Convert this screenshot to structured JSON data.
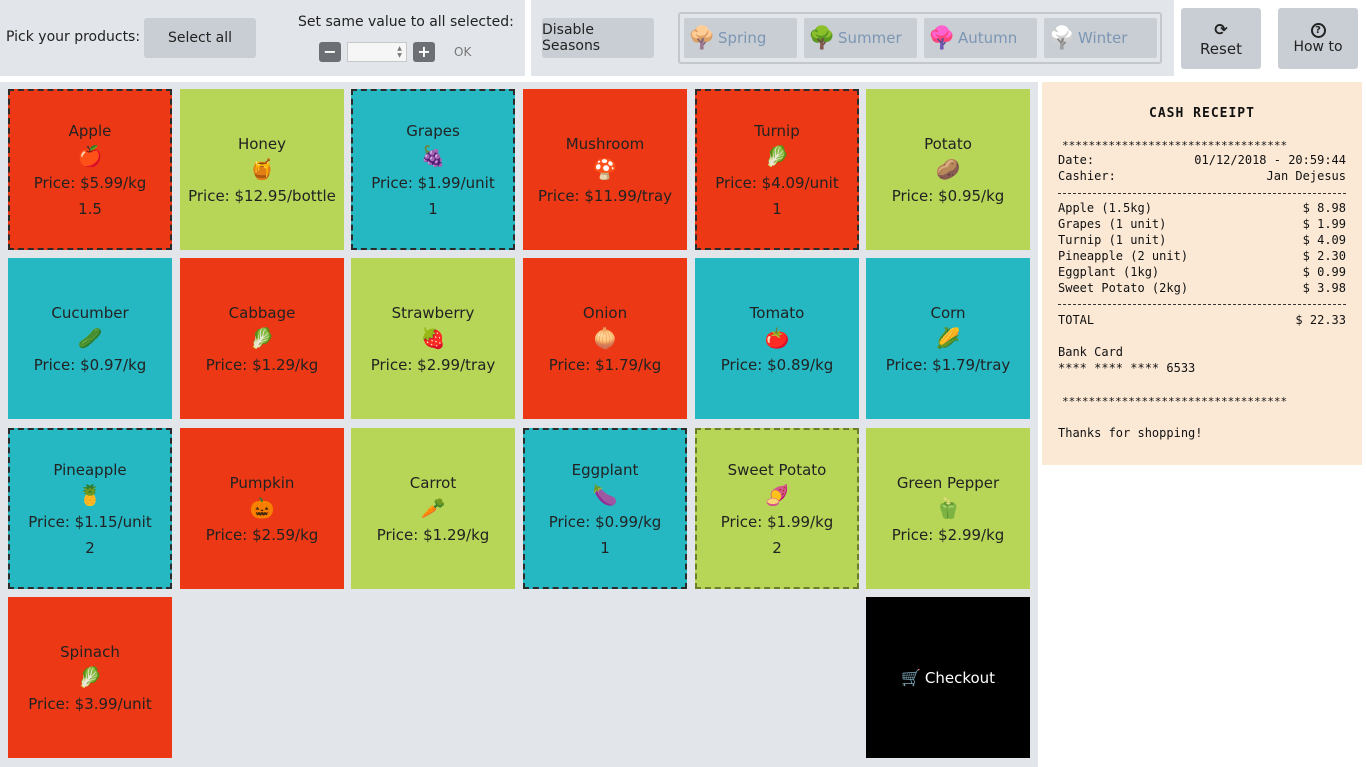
{
  "toolbar": {
    "pick_label": "Pick your products:",
    "select_all": "Select all",
    "same_value_label": "Set same value to all selected:",
    "minus": "−",
    "plus": "+",
    "qty_value": "",
    "ok": "OK",
    "disable_seasons": "Disable Seasons",
    "seasons": [
      {
        "label": "Spring",
        "icon": "🌳"
      },
      {
        "label": "Summer",
        "icon": "🌳"
      },
      {
        "label": "Autumn",
        "icon": "🌳"
      },
      {
        "label": "Winter",
        "icon": "🌳"
      }
    ],
    "reset": "Reset",
    "reset_icon": "⟳",
    "howto": "How to",
    "howto_icon": "?"
  },
  "products": [
    {
      "name": "Apple",
      "icon": "🍎",
      "price": "Price: $5.99/kg",
      "qty": "1.5"
    },
    {
      "name": "Honey",
      "icon": "🍯",
      "price": "Price: $12.95/bottle",
      "qty": ""
    },
    {
      "name": "Grapes",
      "icon": "🍇",
      "price": "Price: $1.99/unit",
      "qty": "1"
    },
    {
      "name": "Mushroom",
      "icon": "🍄",
      "price": "Price: $11.99/tray",
      "qty": ""
    },
    {
      "name": "Turnip",
      "icon": "🥬",
      "price": "Price: $4.09/unit",
      "qty": "1"
    },
    {
      "name": "Potato",
      "icon": "🥔",
      "price": "Price: $0.95/kg",
      "qty": ""
    },
    {
      "name": "Cucumber",
      "icon": "🥒",
      "price": "Price: $0.97/kg",
      "qty": ""
    },
    {
      "name": "Cabbage",
      "icon": "🥬",
      "price": "Price: $1.29/kg",
      "qty": ""
    },
    {
      "name": "Strawberry",
      "icon": "🍓",
      "price": "Price: $2.99/tray",
      "qty": ""
    },
    {
      "name": "Onion",
      "icon": "🧅",
      "price": "Price: $1.79/kg",
      "qty": ""
    },
    {
      "name": "Tomato",
      "icon": "🍅",
      "price": "Price: $0.89/kg",
      "qty": ""
    },
    {
      "name": "Corn",
      "icon": "🌽",
      "price": "Price: $1.79/tray",
      "qty": ""
    },
    {
      "name": "Pineapple",
      "icon": "🍍",
      "price": "Price: $1.15/unit",
      "qty": "2"
    },
    {
      "name": "Pumpkin",
      "icon": "🎃",
      "price": "Price: $2.59/kg",
      "qty": ""
    },
    {
      "name": "Carrot",
      "icon": "🥕",
      "price": "Price: $1.29/kg",
      "qty": ""
    },
    {
      "name": "Eggplant",
      "icon": "🍆",
      "price": "Price: $0.99/kg",
      "qty": "1"
    },
    {
      "name": "Sweet Potato",
      "icon": "🍠",
      "price": "Price: $1.99/kg",
      "qty": "2"
    },
    {
      "name": "Green Pepper",
      "icon": "🫑",
      "price": "Price: $2.99/kg",
      "qty": ""
    },
    {
      "name": "Spinach",
      "icon": "🥬",
      "price": "Price: $3.99/unit",
      "qty": ""
    }
  ],
  "checkout": {
    "label": "Checkout",
    "icon": "🛒"
  },
  "receipt": {
    "title": "CASH RECEIPT",
    "stars": "**********************************",
    "date_label": "Date:",
    "date_value": "01/12/2018 - 20:59:44",
    "cashier_label": "Cashier:",
    "cashier_value": "Jan Dejesus",
    "items": [
      {
        "label": "Apple (1.5kg)",
        "amount": "$ 8.98"
      },
      {
        "label": "Grapes (1 unit)",
        "amount": "$ 1.99"
      },
      {
        "label": "Turnip (1 unit)",
        "amount": "$ 4.09"
      },
      {
        "label": "Pineapple (2 unit)",
        "amount": "$ 2.30"
      },
      {
        "label": "Eggplant (1kg)",
        "amount": "$ 0.99"
      },
      {
        "label": "Sweet Potato (2kg)",
        "amount": "$ 3.98"
      }
    ],
    "total_label": "TOTAL",
    "total_value": "$ 22.33",
    "payment_method": "Bank Card",
    "card_number": "**** **** **** 6533",
    "thanks": "Thanks for shopping!"
  },
  "colors": {
    "red": "#ec3814",
    "green": "#b7d657",
    "teal": "#25b8c3"
  }
}
